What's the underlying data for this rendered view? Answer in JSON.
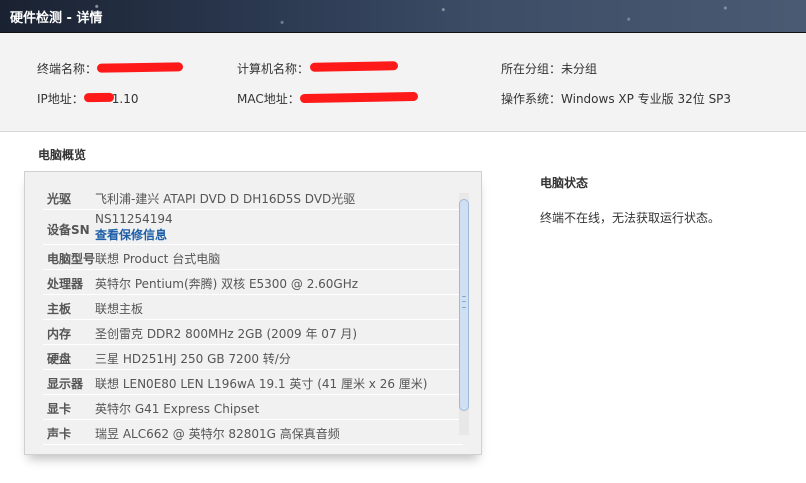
{
  "window": {
    "title": "硬件检测 - 详情"
  },
  "terminal_info": {
    "terminal_name": {
      "label": "终端名称：",
      "value": ""
    },
    "computer_name": {
      "label": "计算机名称：",
      "value": ""
    },
    "group": {
      "label": "所在分组：",
      "value": "未分组"
    },
    "ip": {
      "label": "IP地址：",
      "value": "1.10"
    },
    "mac": {
      "label": "MAC地址：",
      "value": ""
    },
    "os": {
      "label": "操作系统：",
      "value": "Windows XP 专业版 32位 SP3"
    }
  },
  "overview": {
    "title": "电脑概览",
    "rows": [
      {
        "key": "光驱",
        "value": "飞利浦-建兴 ATAPI DVD D DH16D5S DVD光驱"
      },
      {
        "key": "设备SN",
        "value": "NS11254194",
        "link": "查看保修信息"
      },
      {
        "key": "电脑型号",
        "value": "联想 Product 台式电脑"
      },
      {
        "key": "处理器",
        "value": "英特尔 Pentium(奔腾) 双核 E5300 @ 2.60GHz"
      },
      {
        "key": "主板",
        "value": "联想主板"
      },
      {
        "key": "内存",
        "value": "圣创雷克 DDR2 800MHz 2GB (2009 年 07 月)"
      },
      {
        "key": "硬盘",
        "value": "三星 HD251HJ 250 GB 7200 转/分"
      },
      {
        "key": "显示器",
        "value": "联想 LEN0E80 LEN L196wA 19.1 英寸 (41 厘米 x 26 厘米)"
      },
      {
        "key": "显卡",
        "value": "英特尔 G41 Express Chipset"
      },
      {
        "key": "声卡",
        "value": "瑞昱 ALC662 @ 英特尔 82801G 高保真音频"
      }
    ]
  },
  "status": {
    "title": "电脑状态",
    "message": "终端不在线，无法获取运行状态。"
  },
  "colors": {
    "link": "#1f5fa8",
    "redaction": "#ff1a1a",
    "titlebar": "#2c3a52"
  }
}
